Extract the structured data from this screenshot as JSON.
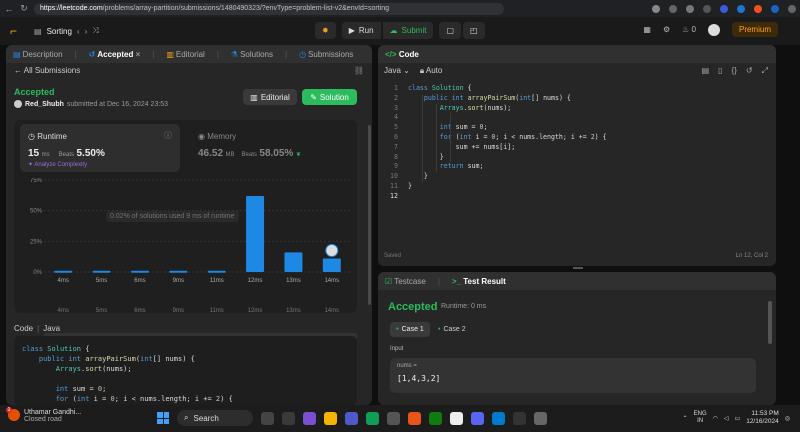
{
  "browser": {
    "url_host": "https://leetcode.com",
    "url_path": "/problems/array-partition/submissions/1480490323/?envType=problem-list-v2&envId=sorting"
  },
  "header": {
    "problem_list": "Sorting",
    "run_label": "Run",
    "submit_label": "Submit",
    "streak": "0",
    "premium_label": "Premium"
  },
  "left_tabs": [
    {
      "label": "Description"
    },
    {
      "label": "Accepted"
    },
    {
      "label": "Editorial"
    },
    {
      "label": "Solutions"
    },
    {
      "label": "Submissions"
    }
  ],
  "submission": {
    "back_label": "All Submissions",
    "status": "Accepted",
    "user": "Red_Shubh",
    "submitted_text": "submitted at Dec 16, 2024 23:53",
    "editorial_btn": "Editorial",
    "solution_btn": "Solution",
    "runtime_label": "Runtime",
    "runtime_value": "15",
    "runtime_unit": "ms",
    "beats_label": "Beats",
    "runtime_beats": "5.50%",
    "analyze_label": "Analyze Complexity",
    "memory_label": "Memory",
    "memory_value": "46.52",
    "memory_unit": "MB",
    "memory_beats": "58.05%",
    "tooltip": "0.02% of solutions used 9 ms of runtime"
  },
  "chart_data": {
    "type": "bar",
    "categories": [
      "4ms",
      "5ms",
      "6ms",
      "9ms",
      "11ms",
      "12ms",
      "13ms",
      "14ms"
    ],
    "values": [
      1,
      1,
      1,
      1,
      1,
      62,
      16,
      11
    ],
    "yticks": [
      "75%",
      "50%",
      "25%",
      "0%"
    ],
    "ylim": [
      0,
      75
    ],
    "highlight_category": "14ms",
    "bar_color": "#1e88e5"
  },
  "code_section": {
    "label": "Code",
    "lang": "Java",
    "lines": [
      "class Solution {",
      "    public int arrayPairSum(int[] nums) {",
      "        Arrays.sort(nums);",
      "",
      "        int sum = 0;",
      "        for (int i = 0; i < nums.length; i += 2) {"
    ]
  },
  "code_panel": {
    "title": "Code",
    "language": "Java",
    "mode": "Auto",
    "line_numbers": [
      "1",
      "2",
      "3",
      "4",
      "5",
      "6",
      "7",
      "8",
      "9",
      "10",
      "11",
      "12"
    ],
    "lines": [
      "class Solution {",
      "    public int arrayPairSum(int[] nums) {",
      "        Arrays.sort(nums);",
      "",
      "        int sum = 0;",
      "        for (int i = 0; i < nums.length; i += 2) {",
      "            sum += nums[i];",
      "        }",
      "        return sum;",
      "    }",
      "}",
      ""
    ],
    "saved": "Saved",
    "cursor": "Ln 12, Col 2"
  },
  "test_panel": {
    "tab_testcase": "Testcase",
    "tab_result": "Test Result",
    "status": "Accepted",
    "runtime": "Runtime: 0 ms",
    "case1": "Case 1",
    "case2": "Case 2",
    "input_label": "Input",
    "input_name": "nums =",
    "input_value": "[1,4,3,2]"
  },
  "taskbar": {
    "weather_title": "Uthamar Gandhi...",
    "weather_sub": "Closed road",
    "weather_badge": "1",
    "search_label": "Search",
    "lang_top": "ENG",
    "lang_bottom": "IN",
    "time": "11:53 PM",
    "date": "12/16/2024"
  }
}
